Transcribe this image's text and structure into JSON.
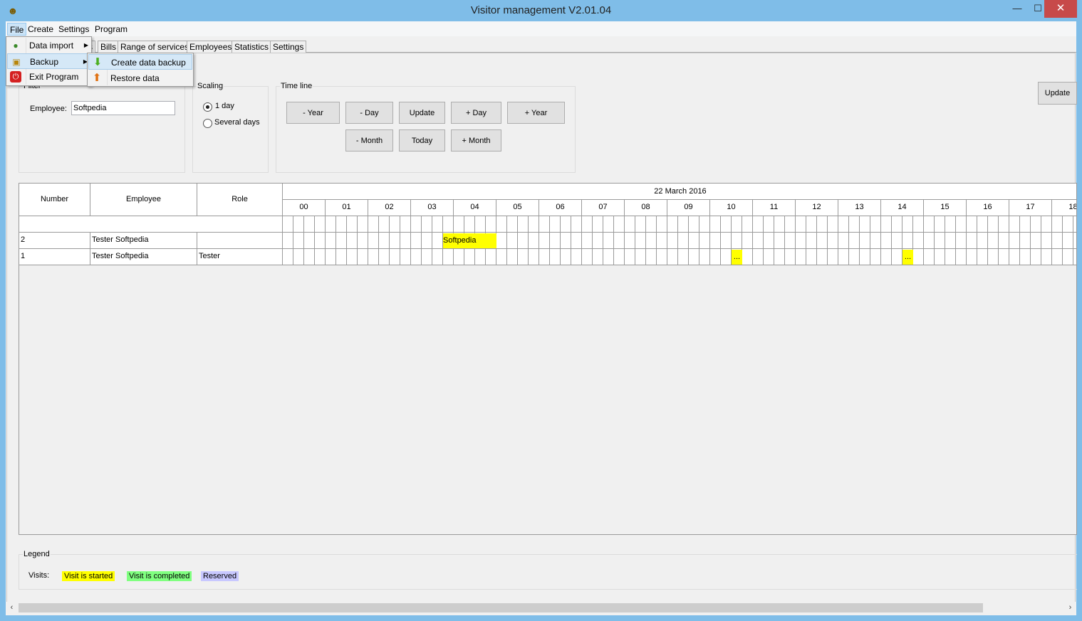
{
  "window": {
    "title": "Visitor management V2.01.04",
    "minimize_glyph": "—",
    "maximize_glyph": "☐",
    "close_glyph": "✕",
    "app_icon": "smiley-icon"
  },
  "menubar": [
    "File",
    "Create",
    "Settings",
    "Program"
  ],
  "tabs": [
    "s",
    "Bills",
    "Range of services",
    "Employees",
    "Statistics",
    "Settings"
  ],
  "file_menu": {
    "items": [
      {
        "label": "Data import",
        "icon": "import-icon",
        "has_submenu": true
      },
      {
        "label": "Backup",
        "icon": "lock-icon",
        "has_submenu": true
      },
      {
        "label": "Exit Program",
        "icon": "power-icon",
        "has_submenu": false
      }
    ]
  },
  "backup_submenu": {
    "items": [
      {
        "label": "Create data backup",
        "icon": "arrow-down-icon"
      },
      {
        "label": "Restore data",
        "icon": "arrow-up-icon"
      }
    ]
  },
  "filter": {
    "title": "Filter",
    "employee_label": "Employee:",
    "employee_value": "Softpedia"
  },
  "scaling": {
    "title": "Scaling",
    "options": [
      "1 day",
      "Several days"
    ],
    "selected": "1 day"
  },
  "timeline": {
    "title": "Time line",
    "buttons_row1": [
      "- Year",
      "- Day",
      "Update",
      "+ Day",
      "+ Year"
    ],
    "buttons_row2": [
      "- Month",
      "Today",
      "+ Month"
    ]
  },
  "update_button": "Update",
  "grid": {
    "columns": [
      "Number",
      "Employee",
      "Role"
    ],
    "date": "22 March 2016",
    "hours": [
      "00",
      "01",
      "02",
      "03",
      "04",
      "05",
      "06",
      "07",
      "08",
      "09",
      "10",
      "11",
      "12",
      "13",
      "14",
      "15",
      "16",
      "17",
      "18"
    ],
    "rows": [
      {
        "number": "2",
        "employee": "Tester Softpedia",
        "role": ""
      },
      {
        "number": "1",
        "employee": "Tester Softpedia",
        "role": "Tester"
      }
    ],
    "events": [
      {
        "row": 0,
        "label": "Softpedia",
        "start_hour": 3.75,
        "end_hour": 5.0
      },
      {
        "row": 1,
        "label": "...",
        "start_hour": 10.5,
        "end_hour": 10.75
      },
      {
        "row": 1,
        "label": "...",
        "start_hour": 14.5,
        "end_hour": 14.75
      }
    ],
    "scroll_left_glyph": "‹"
  },
  "legend": {
    "title": "Legend",
    "visits_label": "Visits:",
    "items": [
      {
        "label": "Visit is started",
        "color": "#ffff00"
      },
      {
        "label": "Visit is completed",
        "color": "#80ff80"
      },
      {
        "label": "Reserved",
        "color": "#c8c8ff"
      }
    ]
  },
  "bottom_scroll": {
    "left_glyph": "‹",
    "right_glyph": "›"
  }
}
